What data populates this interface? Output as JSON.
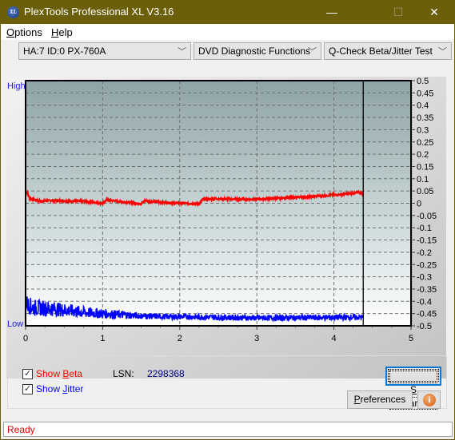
{
  "window": {
    "title": "PlexTools Professional XL V3.16",
    "icon_text": "XL",
    "controls": {
      "minimize": "—",
      "maximize": "☐",
      "close": "✕"
    }
  },
  "menu": [
    {
      "label": "Options",
      "accel": "O"
    },
    {
      "label": "Help",
      "accel": "H"
    }
  ],
  "toolbar": {
    "drive": "HA:7 ID:0  PX-760A",
    "function_group": "DVD Diagnostic Functions",
    "test": "Q-Check Beta/Jitter Test"
  },
  "chart_data": {
    "type": "line",
    "title": "",
    "y_left_labels": {
      "high": "High",
      "low": "Low"
    },
    "xlabel": "",
    "ylabel": "",
    "xlim": [
      0,
      5
    ],
    "x_ticks": [
      "0",
      "1",
      "2",
      "3",
      "4",
      "5"
    ],
    "ylim": [
      -0.5,
      0.5
    ],
    "y_ticks": [
      "0.5",
      "0.45",
      "0.4",
      "0.35",
      "0.3",
      "0.25",
      "0.2",
      "0.15",
      "0.1",
      "0.05",
      "0",
      "-0.05",
      "-0.1",
      "-0.15",
      "-0.2",
      "-0.25",
      "-0.3",
      "-0.35",
      "-0.4",
      "-0.45",
      "-0.5"
    ],
    "grid": true,
    "end_marker_x": 4.38,
    "series": [
      {
        "name": "Beta",
        "color": "#ff0000",
        "x": [
          0.0,
          0.03,
          0.05,
          0.2,
          0.35,
          0.5,
          0.75,
          1.0,
          1.05,
          1.25,
          1.5,
          1.55,
          1.75,
          2.0,
          2.25,
          2.3,
          2.5,
          2.75,
          3.0,
          3.25,
          3.5,
          3.75,
          4.0,
          4.25,
          4.35,
          4.38
        ],
        "values": [
          0.05,
          0.04,
          0.02,
          0.008,
          0.012,
          0.01,
          0.008,
          0.0,
          0.014,
          0.006,
          -0.002,
          0.01,
          0.004,
          0.0,
          -0.002,
          0.016,
          0.018,
          0.016,
          0.016,
          0.02,
          0.024,
          0.028,
          0.034,
          0.04,
          0.044,
          0.038
        ]
      },
      {
        "name": "Jitter",
        "color": "#0000ff",
        "x": [
          0.0,
          0.03,
          0.1,
          0.3,
          0.5,
          0.75,
          1.0,
          1.25,
          1.5,
          1.75,
          2.0,
          2.5,
          3.0,
          3.5,
          4.0,
          4.38
        ],
        "values": [
          -0.4,
          -0.415,
          -0.425,
          -0.43,
          -0.435,
          -0.445,
          -0.45,
          -0.455,
          -0.46,
          -0.462,
          -0.463,
          -0.465,
          -0.468,
          -0.467,
          -0.466,
          -0.465
        ]
      }
    ]
  },
  "options": {
    "show_beta": {
      "label": "Show Beta",
      "accel": "B",
      "checked": true,
      "color": "#ff0000"
    },
    "show_jitter": {
      "label": "Show Jitter",
      "accel": "J",
      "checked": true,
      "color": "#0000ff"
    }
  },
  "lsn": {
    "label": "LSN:",
    "value": "2298368"
  },
  "buttons": {
    "start": "Start",
    "preferences": "Preferences",
    "info": "i"
  },
  "status": "Ready"
}
